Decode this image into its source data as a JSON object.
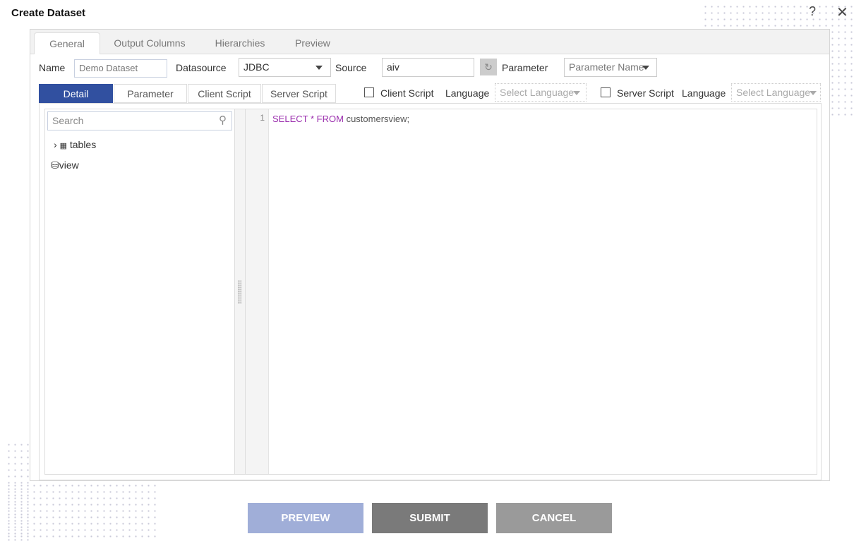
{
  "dialog": {
    "title": "Create Dataset"
  },
  "tabs": [
    "General",
    "Output Columns",
    "Hierarchies",
    "Preview"
  ],
  "form": {
    "name_label": "Name",
    "name_value": "Demo Dataset",
    "datasource_label": "Datasource",
    "datasource_value": "JDBC",
    "source_label": "Source",
    "source_value": "aiv",
    "parameter_label": "Parameter",
    "parameter_value": "Parameter Name"
  },
  "subtabs": [
    "Detail",
    "Parameter",
    "Client Script",
    "Server Script"
  ],
  "scripts": {
    "client_label": "Client Script",
    "server_label": "Server Script",
    "language_label": "Language",
    "language_placeholder": "Select Language"
  },
  "tree": {
    "search_placeholder": "Search",
    "items": [
      "tables",
      "view"
    ]
  },
  "editor": {
    "line_number": "1",
    "kw1": "SELECT",
    "op": "*",
    "kw2": "FROM",
    "rest": "customersview;"
  },
  "buttons": {
    "preview": "PREVIEW",
    "submit": "SUBMIT",
    "cancel": "CANCEL"
  },
  "colors": {
    "accent": "#3150a0",
    "preview_btn": "#a0aed8",
    "submit_btn": "#7a7a7a",
    "cancel_btn": "#9a9a9a",
    "keyword": "#9b2fae"
  }
}
